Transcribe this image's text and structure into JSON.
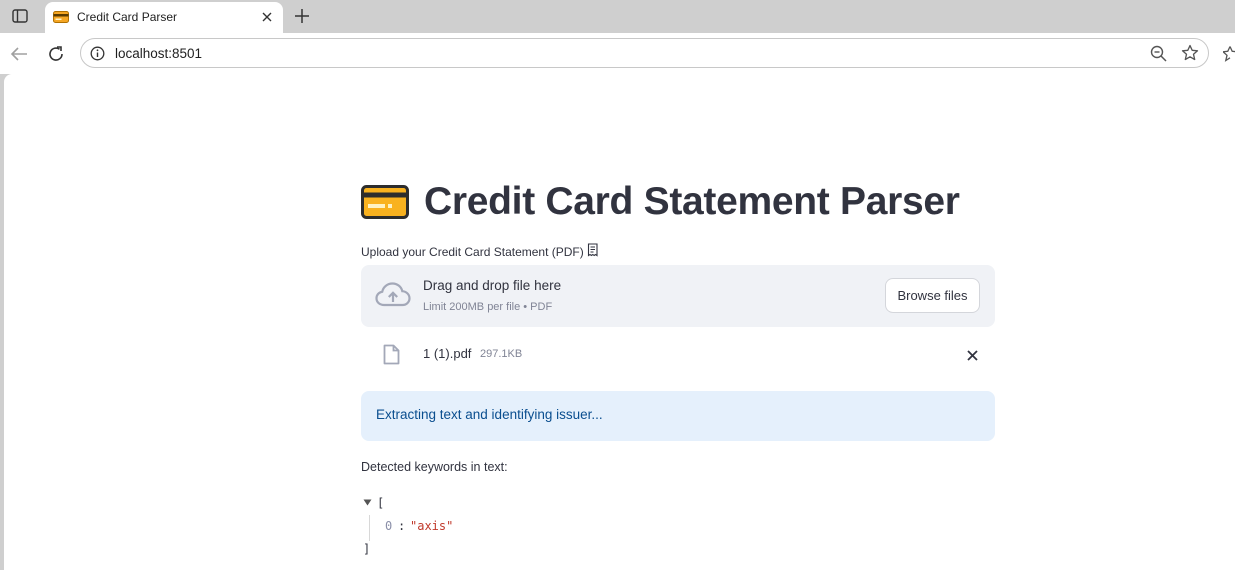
{
  "browser": {
    "tab_title": "Credit Card Parser",
    "url": "localhost:8501"
  },
  "app": {
    "title_emoji": "credit-card-emoji",
    "title": "Credit Card Statement Parser",
    "uploader": {
      "label": "Upload your Credit Card Statement (PDF)",
      "drag_text": "Drag and drop file here",
      "limit_text": "Limit 200MB per file • PDF",
      "browse_label": "Browse files"
    },
    "file": {
      "name": "1 (1).pdf",
      "size": "297.1KB"
    },
    "info_message": "Extracting text and identifying issuer...",
    "keywords_label": "Detected keywords in text:",
    "json": {
      "open_bracket": "[",
      "index": "0",
      "colon": ":",
      "value": "\"axis\"",
      "close_bracket": "]"
    }
  },
  "colors": {
    "text": "#31333f",
    "info_bg": "#e5f0fc",
    "info_text": "#0a4e8f",
    "dropzone_bg": "#f0f2f6",
    "json_string": "#c0392b"
  }
}
